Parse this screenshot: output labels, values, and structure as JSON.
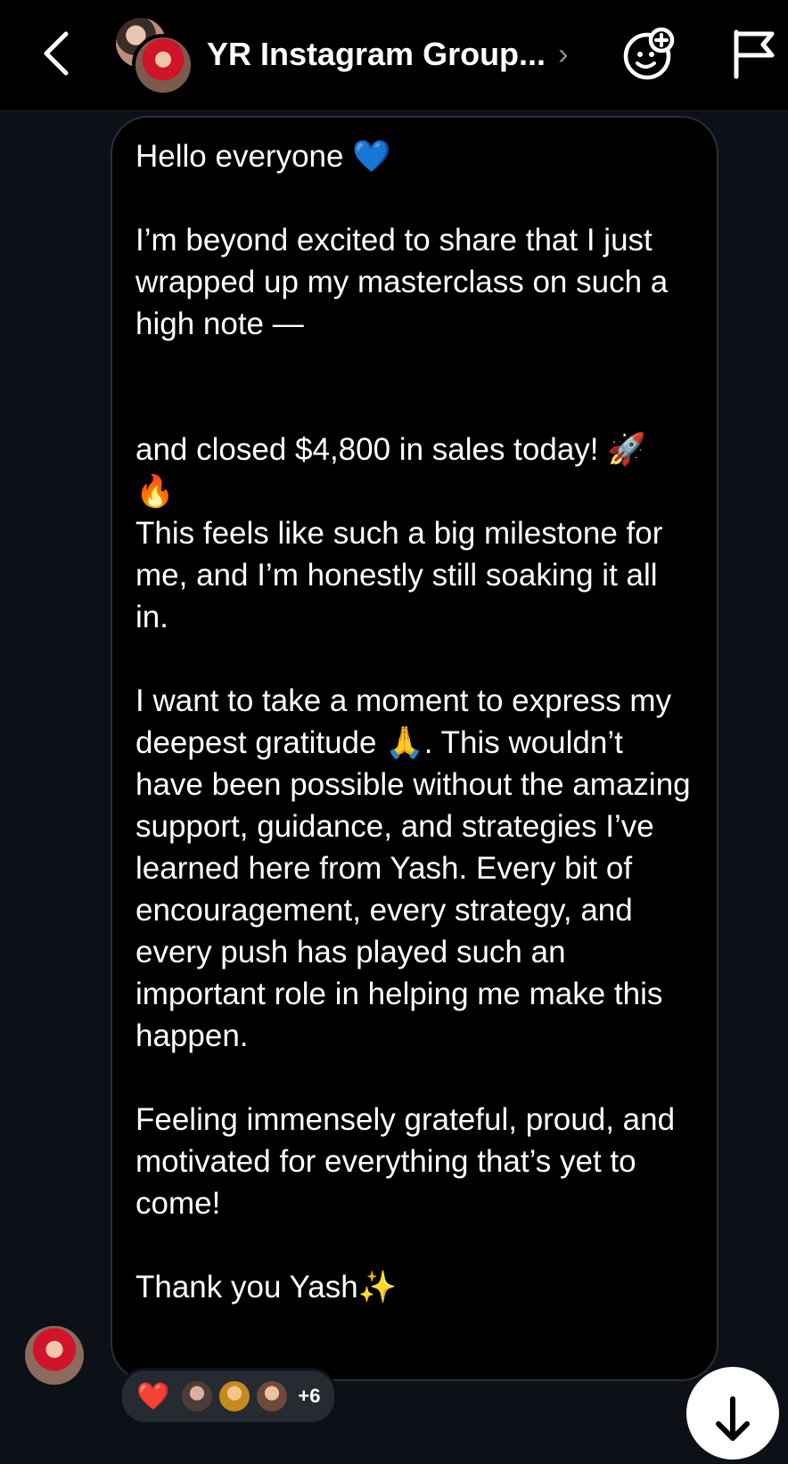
{
  "header": {
    "title": "YR Instagram Group...",
    "title_chevron": "›",
    "icons": [
      "back-icon",
      "sticker-add-icon",
      "flag-icon"
    ]
  },
  "message": {
    "text": "Hello everyone 💙\n\nI’m beyond excited to share that I just wrapped up my masterclass on such a high note —\n\n\nand closed $4,800 in sales today! 🚀 🔥\nThis feels like such a big milestone for me, and I’m honestly still soaking it all in.\n\nI want to take a moment to express my deepest gratitude 🙏. This wouldn’t have been possible without the amazing support, guidance, and strategies I’ve learned here from Yash. Every bit of encouragement, every strategy, and every push has played such an important role in helping me make this happen.\n\nFeeling immensely grateful, proud, and motivated for everything that’s yet to come!\n\nThank you Yash✨"
  },
  "reactions": {
    "emoji": "❤️",
    "more_count": "+6"
  },
  "colors": {
    "background": "#0c1017",
    "header": "#000000",
    "bubble": "#000000",
    "reaction_pill": "#262a31"
  }
}
